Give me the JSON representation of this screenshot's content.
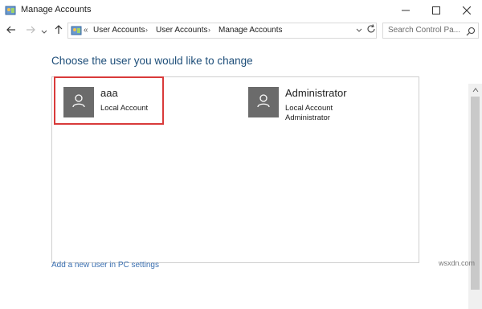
{
  "window": {
    "title": "Manage Accounts"
  },
  "address": {
    "overflow": "«",
    "breadcrumbs": [
      "User Accounts",
      "User Accounts",
      "Manage Accounts"
    ],
    "separator": "›"
  },
  "search": {
    "placeholder": "Search Control Pa..."
  },
  "main": {
    "heading": "Choose the user you would like to change",
    "users": [
      {
        "name": "aaa",
        "lines": [
          "Local Account"
        ]
      },
      {
        "name": "Administrator",
        "lines": [
          "Local Account",
          "Administrator"
        ]
      }
    ],
    "bottom_link": "Add a new user in PC settings"
  },
  "watermark": "wsxdn.com",
  "colors": {
    "accent": "#1e4e79",
    "highlight": "#d93a3a",
    "avatar_bg": "#6b6b6b",
    "link": "#3a6fb0"
  },
  "icons": {
    "app": "control-panel-icon",
    "back": "back-arrow-icon",
    "forward": "forward-arrow-icon",
    "up": "up-arrow-icon",
    "refresh": "refresh-icon",
    "search": "search-icon",
    "avatar": "user-silhouette-icon"
  }
}
